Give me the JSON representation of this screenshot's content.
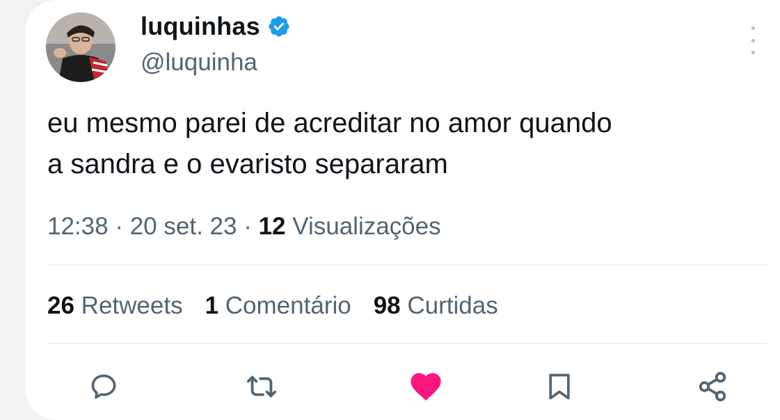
{
  "author": {
    "display_name": "luquinhas",
    "handle": "@luquinha",
    "avatar_icon": "profile-photo",
    "verified_icon": "verified-badge-icon",
    "verified_color": "#1d9bf0"
  },
  "tweet": {
    "text_line1": "eu mesmo parei de acreditar no amor quando",
    "text_line2": "a sandra e o evaristo separaram"
  },
  "meta": {
    "time": "12:38",
    "separator": "·",
    "date": "20 set. 23",
    "views_count": "12",
    "views_label": "Visualizações"
  },
  "stats": {
    "retweets_count": "26",
    "retweets_label": "Retweets",
    "comments_count": "1",
    "comments_label": "Comentário",
    "likes_count": "98",
    "likes_label": "Curtidas"
  },
  "actions": {
    "reply_icon": "reply-icon",
    "retweet_icon": "retweet-icon",
    "like_icon": "heart-icon",
    "like_color": "#f91880",
    "bookmark_icon": "bookmark-icon",
    "share_icon": "share-icon",
    "icon_color": "#536471"
  },
  "colors": {
    "text_primary": "#0f1419",
    "text_secondary": "#536471",
    "background": "#ffffff"
  }
}
